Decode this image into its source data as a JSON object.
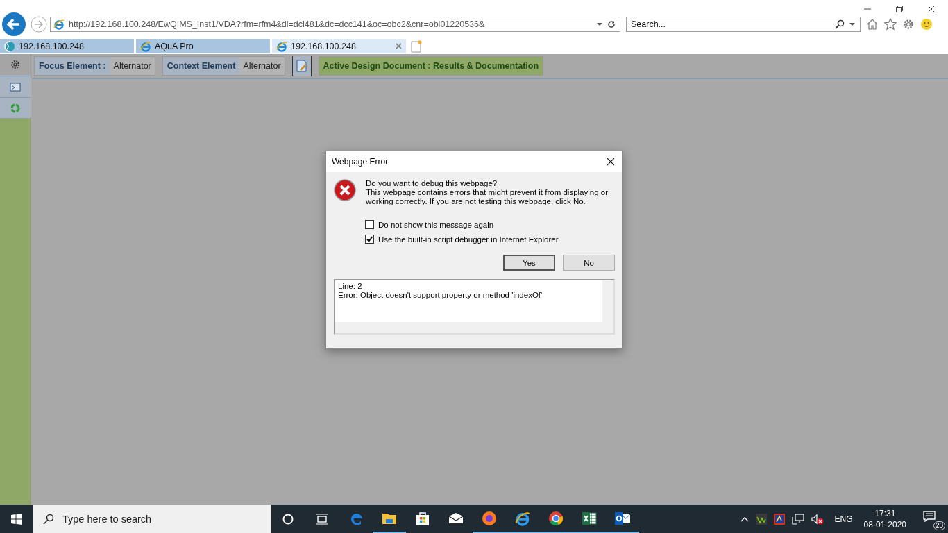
{
  "browser": {
    "address": "http://192.168.100.248/EwQIMS_Inst1/VDA?rfm=rfm4&di=dci481&dc=dcc141&oc=obc2&cnr=obi01220536&",
    "search": {
      "placeholder": "Search..."
    },
    "tabs": [
      {
        "title": "192.168.100.248",
        "kind": "site",
        "selected": false
      },
      {
        "title": "AQuA Pro",
        "kind": "ie",
        "selected": false
      },
      {
        "title": "192.168.100.248",
        "kind": "ie",
        "selected": true
      }
    ]
  },
  "toolbar": {
    "focus_label": "Focus Element :",
    "focus_value": "Alternator",
    "context_label": "Context Element",
    "context_value": "Alternator",
    "active_document": "Active Design Document : Results & Documentation"
  },
  "dialog": {
    "title": "Webpage Error",
    "heading": "Do you want to debug this webpage?",
    "message": "This webpage contains errors that might prevent it from displaying or working correctly. If you are not testing this webpage, click No.",
    "options": [
      {
        "label": "Do not show this message again",
        "checked": false
      },
      {
        "label": "Use the built-in script debugger in Internet Explorer",
        "checked": true
      }
    ],
    "buttons": [
      {
        "label": "Yes",
        "selected": true
      },
      {
        "label": "No",
        "selected": false
      }
    ],
    "details": [
      "Line: 2",
      "Error: Object doesn't support property or method 'indexOf'"
    ]
  },
  "taskbar": {
    "search": {
      "placeholder": "Type here to search"
    },
    "apps": [
      {
        "kind": "edge",
        "running": false
      },
      {
        "kind": "explorer",
        "running": true
      },
      {
        "kind": "store",
        "running": false
      },
      {
        "kind": "mail",
        "running": false
      },
      {
        "kind": "firefox",
        "running": true
      },
      {
        "kind": "ie",
        "running": true
      },
      {
        "kind": "chrome",
        "running": true
      },
      {
        "kind": "excel",
        "running": true
      },
      {
        "kind": "outlook",
        "running": true
      }
    ],
    "language": "ENG",
    "time": "17:31",
    "date": "08-01-2020",
    "notifications": "20"
  }
}
